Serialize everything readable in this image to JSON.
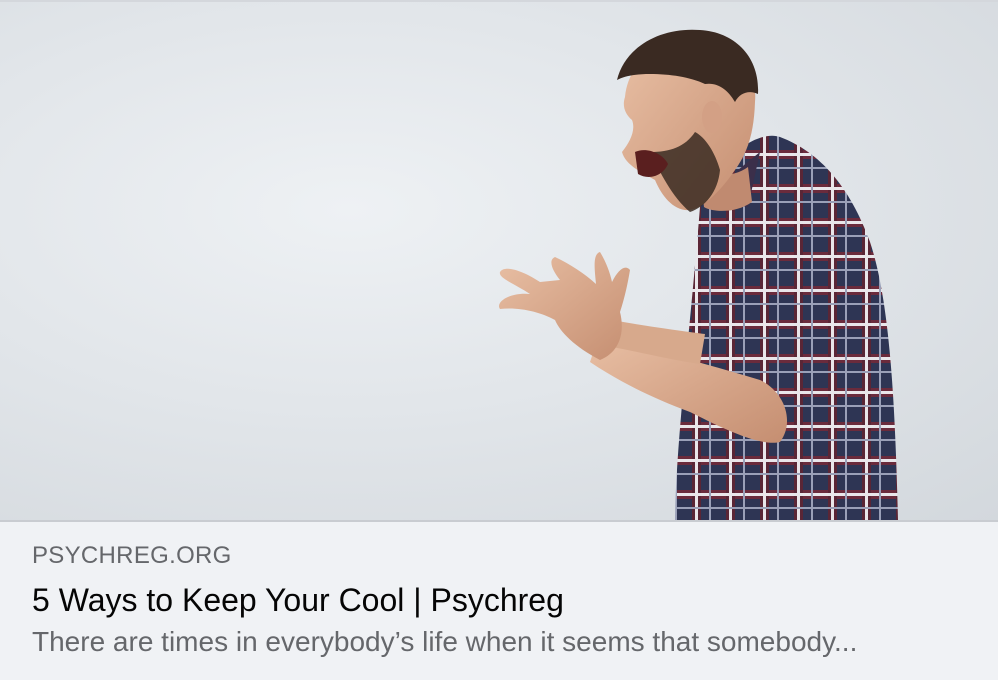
{
  "link_preview": {
    "image_icon": "photo-angry-man-shouting",
    "domain": "PSYCHREG.ORG",
    "title": "5 Ways to Keep Your Cool | Psychreg",
    "description": "There are times in everybody’s life when it seems that somebody..."
  }
}
